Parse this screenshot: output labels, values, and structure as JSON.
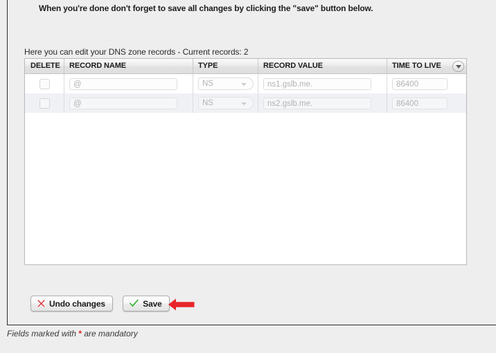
{
  "instruction": "When you're done don't forget to save all changes by clicking the \"save\" button below.",
  "grid": {
    "caption": "Here you can edit your DNS zone records - Current records: 2",
    "menu_icon": "chevron-down-icon",
    "columns": [
      {
        "key": "delete",
        "label": "DELETE"
      },
      {
        "key": "name",
        "label": "RECORD NAME"
      },
      {
        "key": "type",
        "label": "TYPE"
      },
      {
        "key": "value",
        "label": "RECORD VALUE"
      },
      {
        "key": "ttl",
        "label": "TIME TO LIVE"
      }
    ],
    "rows": [
      {
        "delete_checked": false,
        "name": "@",
        "type": "NS",
        "value": "ns1.gslb.me.",
        "ttl": "86400"
      },
      {
        "delete_checked": false,
        "name": "@",
        "type": "NS",
        "value": "ns2.gslb.me.",
        "ttl": "86400"
      }
    ]
  },
  "actions": {
    "undo": {
      "label": "Undo changes",
      "icon": "red-x-icon"
    },
    "save": {
      "label": "Save",
      "icon": "green-check-icon"
    }
  },
  "annotation": {
    "icon": "red-left-arrow-icon",
    "color": "#e8252a"
  },
  "footer": {
    "prefix": "Fields marked with ",
    "star": "*",
    "suffix": " are mandatory"
  },
  "colors": {
    "page_background": "#eeeeee",
    "panel_background": "#ffffff",
    "header_text": "#1a1a1a",
    "placeholder_text": "#b3b3b3",
    "alt_row": "#f0f1f4",
    "accent_red": "#e02020",
    "accent_green": "#3fae3f"
  }
}
